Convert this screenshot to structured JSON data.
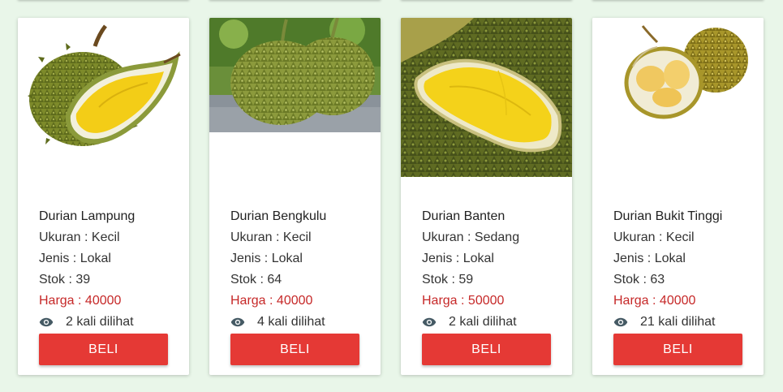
{
  "products": [
    {
      "name": "Durian Lampung",
      "size_label": "Ukuran : ",
      "size": "Kecil",
      "type_label": "Jenis : ",
      "type": "Lokal",
      "stock_label": "Stok : ",
      "stock": "39",
      "price_label": "Harga : ",
      "price": "40000",
      "views": "2 kali dilihat",
      "buy_label": "BELI",
      "image_icon": "durian-open-image"
    },
    {
      "name": "Durian Bengkulu",
      "size_label": "Ukuran : ",
      "size": "Kecil",
      "type_label": "Jenis : ",
      "type": "Lokal",
      "stock_label": "Stok : ",
      "stock": "64",
      "price_label": "Harga : ",
      "price": "40000",
      "views": "4 kali dilihat",
      "buy_label": "BELI",
      "image_icon": "durian-whole-image"
    },
    {
      "name": "Durian Banten",
      "size_label": "Ukuran : ",
      "size": "Sedang",
      "type_label": "Jenis : ",
      "type": "Lokal",
      "stock_label": "Stok : ",
      "stock": "59",
      "price_label": "Harga : ",
      "price": "50000",
      "views": "2 kali dilihat",
      "buy_label": "BELI",
      "image_icon": "durian-flesh-closeup-image"
    },
    {
      "name": "Durian Bukit Tinggi",
      "size_label": "Ukuran : ",
      "size": "Kecil",
      "type_label": "Jenis : ",
      "type": "Lokal",
      "stock_label": "Stok : ",
      "stock": "63",
      "price_label": "Harga : ",
      "price": "40000",
      "views": "21 kali dilihat",
      "buy_label": "BELI",
      "image_icon": "durian-split-image"
    }
  ],
  "colors": {
    "background": "#e9f6e9",
    "price": "#c62828",
    "button": "#e53935"
  }
}
